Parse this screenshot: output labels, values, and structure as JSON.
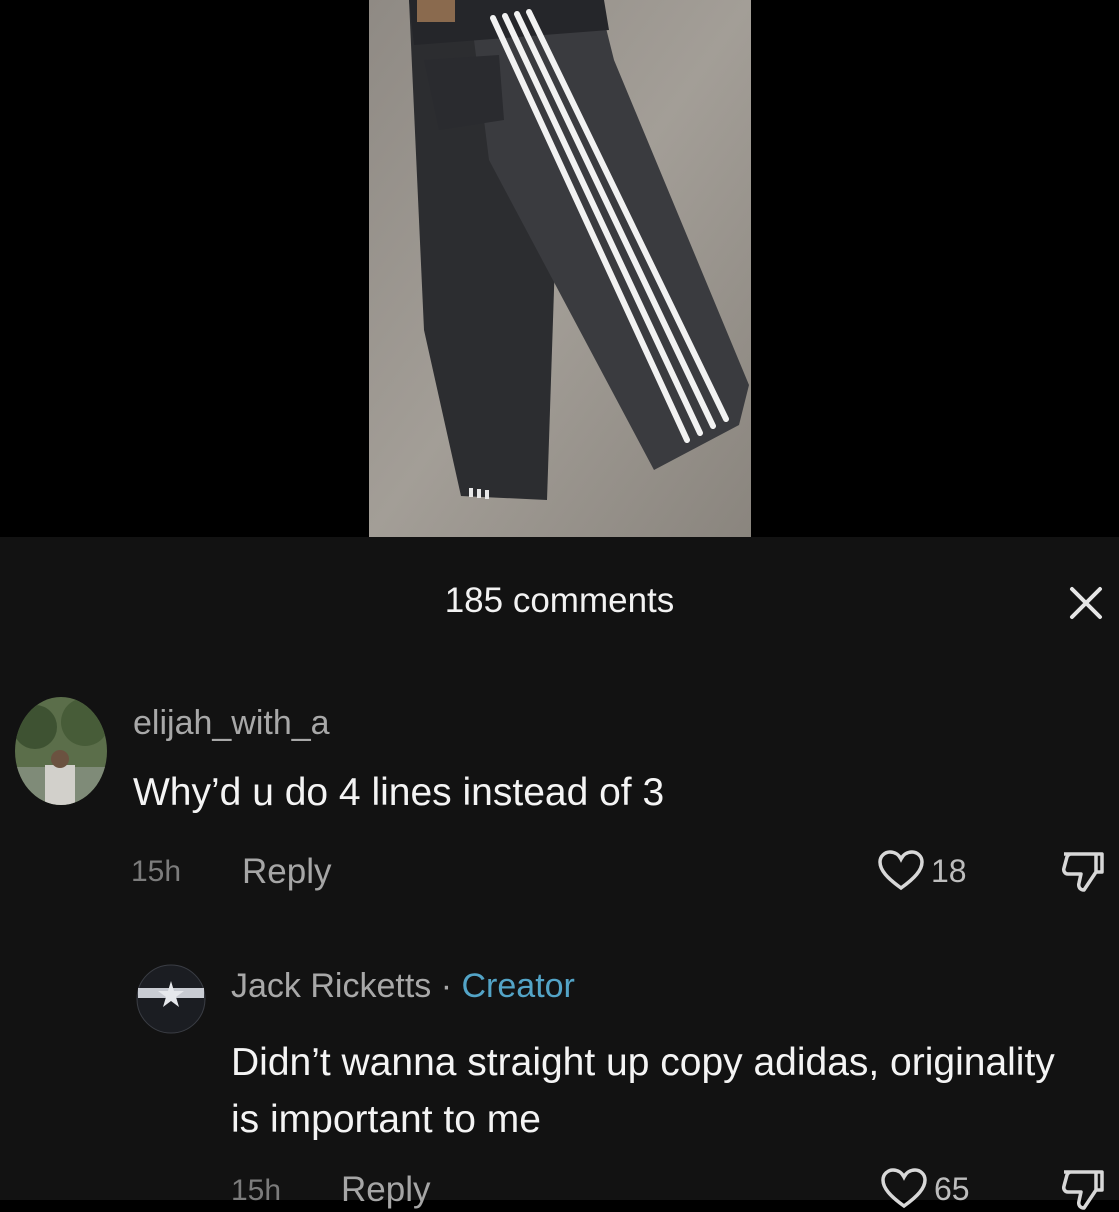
{
  "header": {
    "comment_count": "185 comments"
  },
  "icons": {
    "close": "close-icon",
    "like": "heart-icon",
    "dislike": "thumbs-down-icon"
  },
  "colors": {
    "creator_badge": "#53a4c7",
    "sheet_bg": "#121212"
  },
  "comments": [
    {
      "username": "elijah_with_a",
      "text": "Why’d u do 4 lines instead of 3",
      "time": "15h",
      "reply_label": "Reply",
      "likes": "18"
    },
    {
      "username": "Jack Ricketts",
      "separator": "·",
      "badge": "Creator",
      "text": "Didn’t wanna straight up copy adidas, originality is important to me",
      "time": "15h",
      "reply_label": "Reply",
      "likes": "65"
    }
  ]
}
